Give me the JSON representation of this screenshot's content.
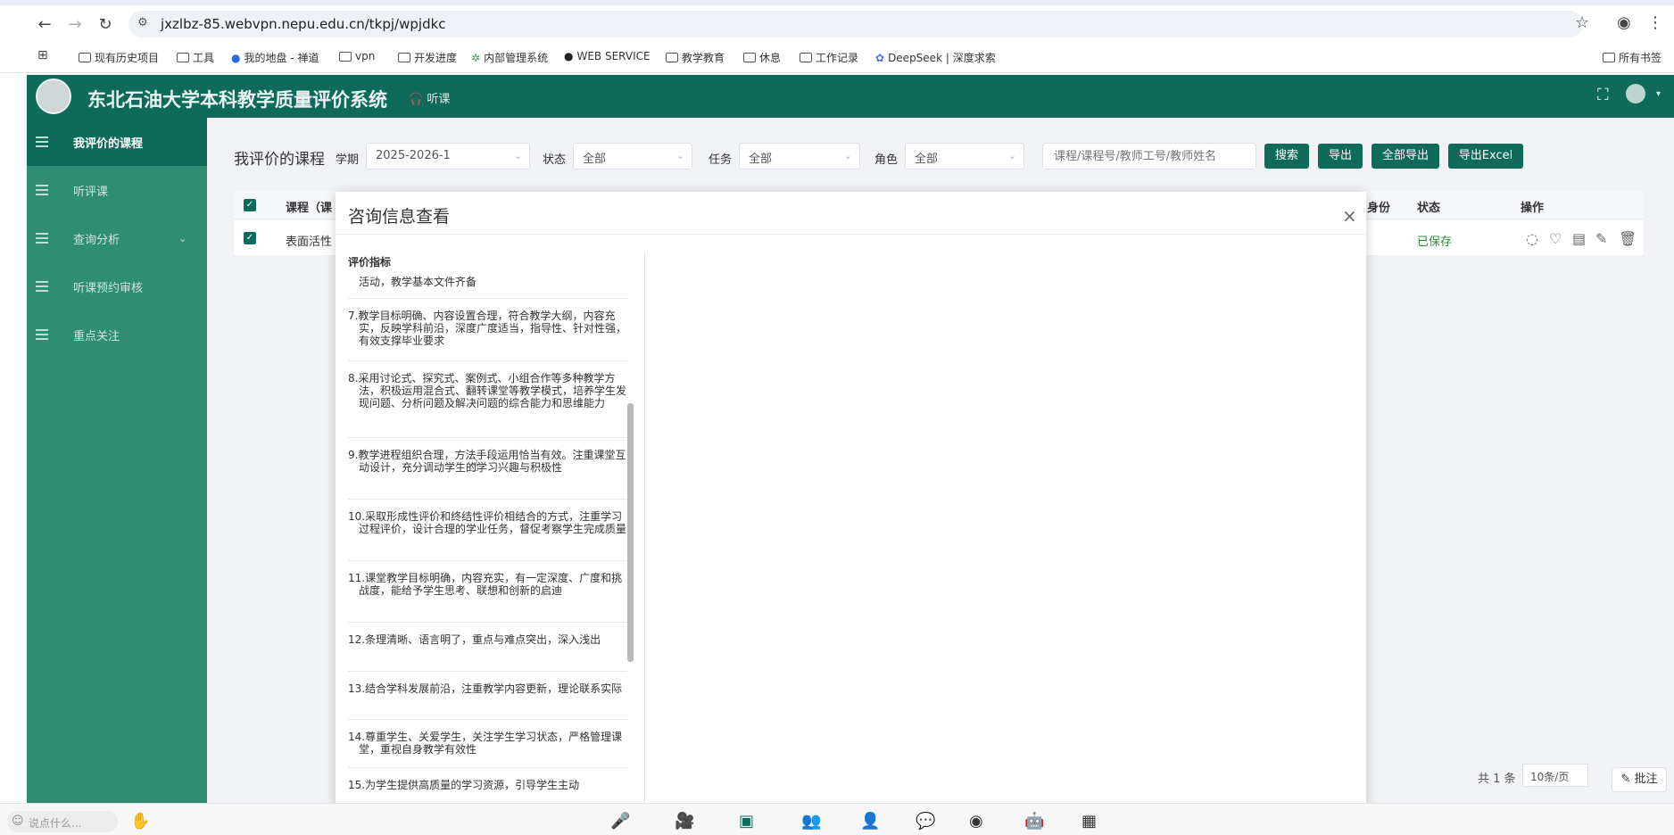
{
  "browser": {
    "url": "jxzlbz-85.webvpn.nepu.edu.cn/tkpj/wpjdkc",
    "bookmarks": [
      "现有历史项目",
      "工具",
      "我的地盘 - 禅道",
      "vpn",
      "开发进度",
      "内部管理系统",
      "WEB SERVICE",
      "教学教育",
      "休息",
      "工作记录",
      "DeepSeek | 深度求索"
    ],
    "all_bookmarks": "所有书签"
  },
  "app": {
    "title": "东北石油大学本科教学质量评价系统",
    "top_nav": "听课"
  },
  "sidebar": {
    "items": [
      {
        "label": "我评价的课程"
      },
      {
        "label": "听评课"
      },
      {
        "label": "查询分析"
      },
      {
        "label": "听课预约审核"
      },
      {
        "label": "重点关注"
      }
    ]
  },
  "toolbar": {
    "section_title": "我评价的课程",
    "term_label": "学期",
    "term_value": "2025-2026-1",
    "status_label": "状态",
    "status_value": "全部",
    "task_label": "任务",
    "task_value": "全部",
    "role_label": "角色",
    "role_value": "全部",
    "search_placeholder": "课程/课程号/教师工号/教师姓名",
    "search_btn": "搜索",
    "export_btn": "导出",
    "export_all_btn": "全部导出",
    "export_excel_btn": "导出Excel"
  },
  "table": {
    "headers": {
      "course": "课程（课",
      "identity": "身份",
      "status": "状态",
      "actions": "操作"
    },
    "rows": [
      {
        "course": "表面活性",
        "status": "已保存"
      }
    ]
  },
  "modal": {
    "title": "咨询信息查看",
    "panel_header": "评价指标",
    "first_fragment": "活动，教学基本文件齐备",
    "criteria": [
      "7.教学目标明确、内容设置合理，符合教学大纲，内容充实，反映学科前沿，深度广度适当，指导性、针对性强，有效支撑毕业要求",
      "8.采用讨论式、探究式、案例式、小组合作等多种教学方法，积极运用混合式、翻转课堂等教学模式，培养学生发现问题、分析问题及解决问题的综合能力和思维能力",
      "9.教学进程组织合理，方法手段运用恰当有效。注重课堂互动设计，充分调动学生的学习兴趣与积极性",
      "10.采取形成性评价和终结性评价相结合的方式，注重学习过程评价，设计合理的学业任务，督促考察学生完成质量",
      "11.课堂教学目标明确，内容充实，有一定深度、广度和挑战度，能给予学生思考、联想和创新的启迪",
      "12.条理清晰、语言明了，重点与难点突出，深入浅出",
      "13.结合学科发展前沿，注重教学内容更新，理论联系实际",
      "14.尊重学生、关爱学生，关注学生学习状态，严格管理课堂，重视自身教学有效性",
      "15.为学生提供高质量的学习资源，引导学生主动"
    ]
  },
  "pagination": {
    "total": "共 1 条",
    "page_size": "10条/页"
  },
  "annotate_btn": "批注",
  "taskbar": {
    "chat_placeholder": "说点什么..."
  },
  "colors": {
    "header": "#0e6b5c",
    "sidebar": "#2f8e72",
    "status_saved": "#2e8b3a"
  }
}
